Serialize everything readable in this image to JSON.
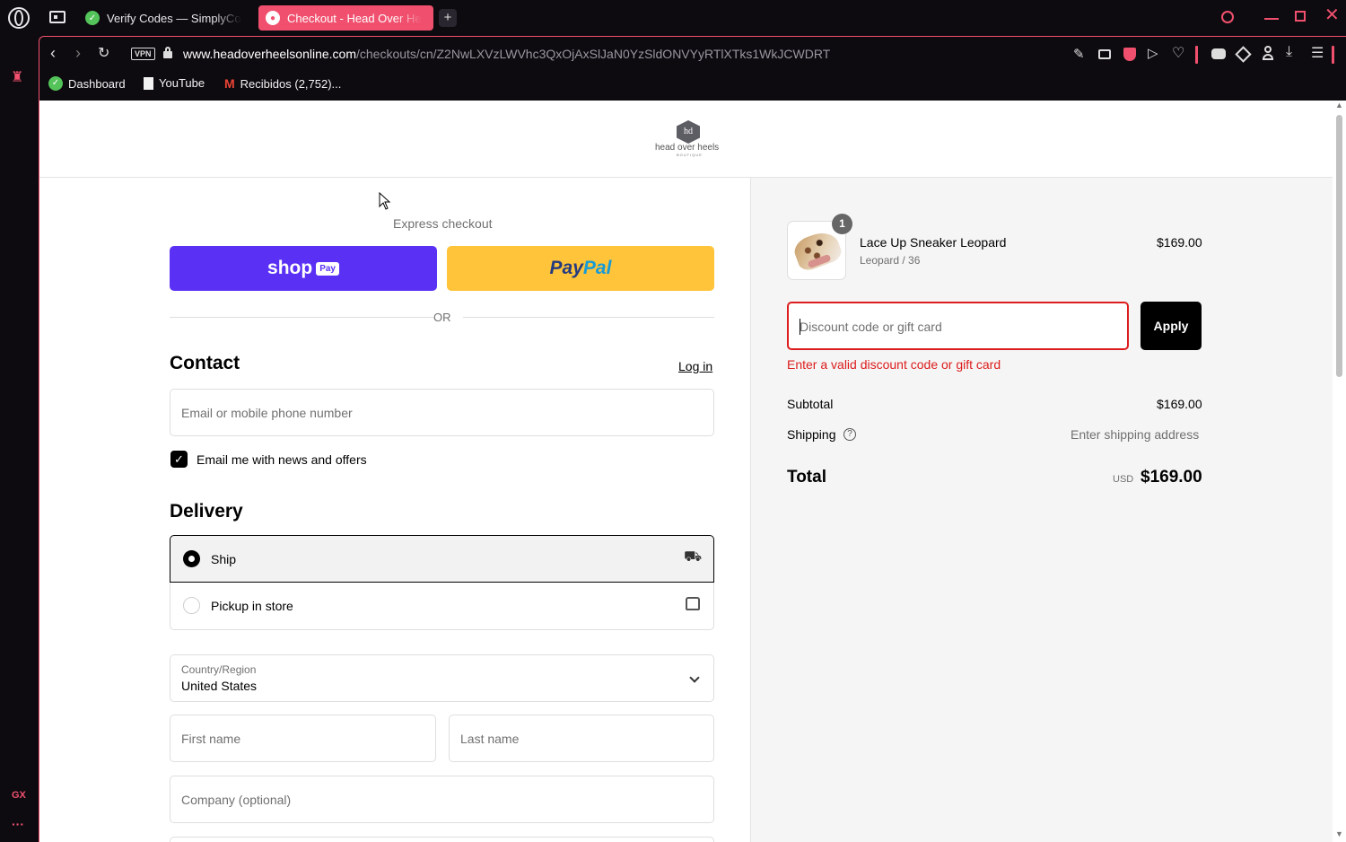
{
  "browser": {
    "tabs": [
      {
        "label": "Verify Codes — SimplyCo",
        "active": false
      },
      {
        "label": "Checkout - Head Over He",
        "active": true
      }
    ],
    "new_tab": "+",
    "url_domain": "www.headoverheelsonline.com",
    "url_path": "/checkouts/cn/Z2NwLXVzLWVhc3QxOjAxSlJaN0YzSldONVYyRTlXTks1WkJCWDRT",
    "vpn_label": "VPN",
    "bookmarks": [
      "Dashboard",
      "YouTube",
      "Recibidos (2,752)..."
    ],
    "sidebar_gx": "GX",
    "sidebar_more": "···"
  },
  "header": {
    "logo_text": "head over heels",
    "logo_sub": "BOUTIQUE"
  },
  "checkout": {
    "express_label": "Express checkout",
    "shop_label": "shop",
    "shop_pay_badge": "Pay",
    "paypal_pay": "Pay",
    "paypal_pal": "Pal",
    "or_label": "OR",
    "contact_title": "Contact",
    "login_link": "Log in",
    "email_placeholder": "Email or mobile phone number",
    "news_checkbox_label": "Email me with news and offers",
    "news_checked": true,
    "delivery_title": "Delivery",
    "ship_label": "Ship",
    "pickup_label": "Pickup in store",
    "country_label": "Country/Region",
    "country_value": "United States",
    "first_name_placeholder": "First name",
    "last_name_placeholder": "Last name",
    "company_placeholder": "Company (optional)"
  },
  "summary": {
    "item_qty": "1",
    "item_name": "Lace Up Sneaker Leopard",
    "item_variant": "Leopard / 36",
    "item_price": "$169.00",
    "discount_placeholder": "Discount code or gift card",
    "apply_label": "Apply",
    "discount_error": "Enter a valid discount code or gift card",
    "subtotal_label": "Subtotal",
    "subtotal_value": "$169.00",
    "shipping_label": "Shipping",
    "shipping_value": "Enter shipping address",
    "total_label": "Total",
    "currency": "USD",
    "total_value": "$169.00"
  },
  "colors": {
    "accent": "#f0506e",
    "shop_pay": "#5a31f4",
    "paypal": "#ffc439",
    "error": "#dd1d1d"
  }
}
